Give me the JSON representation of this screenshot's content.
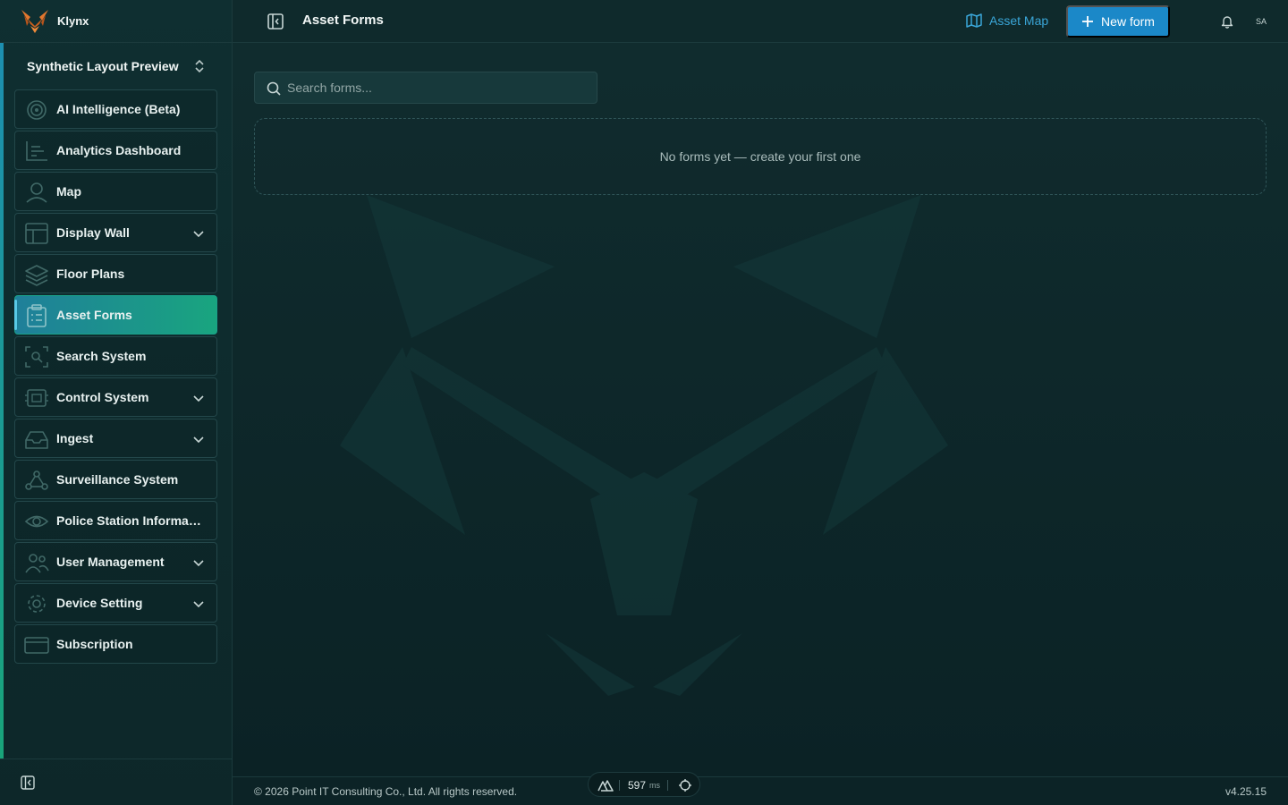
{
  "app": {
    "name": "Klynx",
    "workspace": "Synthetic Layout Preview"
  },
  "sidebar": {
    "items": [
      {
        "label": "AI Intelligence (Beta)",
        "icon": "ai-target-icon",
        "expandable": false,
        "active": false
      },
      {
        "label": "Analytics Dashboard",
        "icon": "chart-icon",
        "expandable": false,
        "active": false
      },
      {
        "label": "Map",
        "icon": "map-pin-icon",
        "expandable": false,
        "active": false
      },
      {
        "label": "Display Wall",
        "icon": "layout-icon",
        "expandable": true,
        "active": false
      },
      {
        "label": "Floor Plans",
        "icon": "layers-icon",
        "expandable": false,
        "active": false
      },
      {
        "label": "Asset Forms",
        "icon": "clipboard-icon",
        "expandable": false,
        "active": true
      },
      {
        "label": "Search System",
        "icon": "scan-search-icon",
        "expandable": false,
        "active": false
      },
      {
        "label": "Control System",
        "icon": "cpu-icon",
        "expandable": true,
        "active": false
      },
      {
        "label": "Ingest",
        "icon": "inbox-icon",
        "expandable": true,
        "active": false
      },
      {
        "label": "Surveillance System",
        "icon": "network-icon",
        "expandable": false,
        "active": false
      },
      {
        "label": "Police Station Informati...",
        "icon": "eye-icon",
        "expandable": false,
        "active": false
      },
      {
        "label": "User Management",
        "icon": "users-icon",
        "expandable": true,
        "active": false
      },
      {
        "label": "Device Setting",
        "icon": "gear-icon",
        "expandable": true,
        "active": false
      },
      {
        "label": "Subscription",
        "icon": "credit-card-icon",
        "expandable": false,
        "active": false
      }
    ]
  },
  "header": {
    "title": "Asset Forms",
    "asset_map_label": "Asset Map",
    "new_form_label": "New form",
    "avatar_initials": "SA"
  },
  "main": {
    "search_placeholder": "Search forms...",
    "search_value": "",
    "empty_message": "No forms yet — create your first one"
  },
  "footer": {
    "copyright": "© 2026 Point IT Consulting Co., Ltd. All rights reserved.",
    "version": "v4.25.15",
    "latency_value": "597",
    "latency_unit": "ms"
  },
  "colors": {
    "accent_blue": "#1b88c8",
    "link_blue": "#3aa6d8",
    "active_gradient_start": "#1f7f9a",
    "active_gradient_end": "#19a57f",
    "brand_orange": "#e2772e"
  }
}
